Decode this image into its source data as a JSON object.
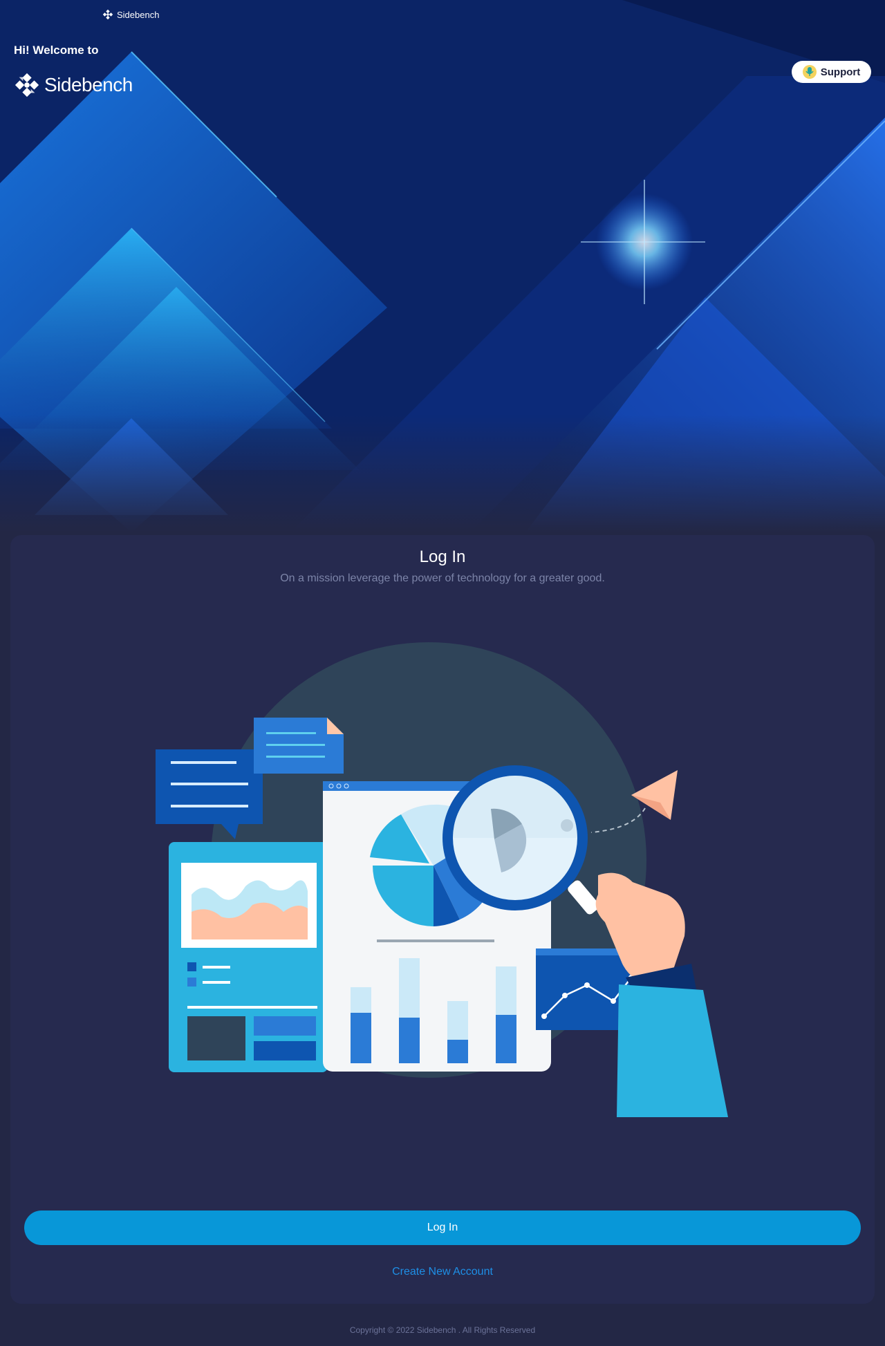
{
  "header": {
    "top_logo_text": "Sidebench",
    "welcome": "Hi! Welcome to",
    "brand": "Sidebench",
    "support_label": "Support"
  },
  "login": {
    "title": "Log In",
    "subtitle": "On a mission leverage the power of technology for a greater good.",
    "login_button": "Log In",
    "create_account": "Create New Account"
  },
  "footer": {
    "copyright": "Copyright © 2022 Sidebench . All Rights Reserved"
  },
  "colors": {
    "page_bg": "#232745",
    "card_bg": "#262a4f",
    "primary": "#0897d8",
    "link": "#1e8fe6"
  },
  "icons": {
    "brand_mark": "sidebench-logo-icon",
    "support": "support-icon"
  }
}
